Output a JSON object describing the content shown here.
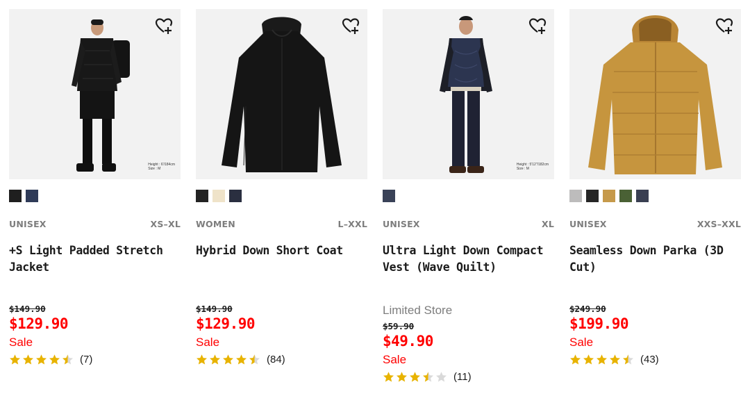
{
  "products": [
    {
      "gender": "UNISEX",
      "size_range": "XS–XL",
      "name": "+S Light Padded Stretch Jacket",
      "note": "",
      "original_price": "$149.90",
      "sale_price": "$129.90",
      "sale_label": "Sale",
      "rating": 4.5,
      "review_count": "(7)",
      "model_note": [
        "Height : 6'/184cm",
        "Size : M"
      ],
      "swatches": [
        "#1f1f1f",
        "#2f3b58"
      ],
      "fav_icon": "heart-plus-icon"
    },
    {
      "gender": "WOMEN",
      "size_range": "L–XXL",
      "name": "Hybrid Down Short Coat",
      "note": "",
      "original_price": "$149.90",
      "sale_price": "$129.90",
      "sale_label": "Sale",
      "rating": 4.5,
      "review_count": "(84)",
      "model_note": [],
      "swatches": [
        "#232323",
        "#efe3c9",
        "#2a2f40"
      ],
      "fav_icon": "heart-plus-icon"
    },
    {
      "gender": "UNISEX",
      "size_range": "XL",
      "name": "Ultra Light Down Compact Vest (Wave Quilt)",
      "note": "Limited Store",
      "original_price": "$59.90",
      "sale_price": "$49.90",
      "sale_label": "Sale",
      "rating": 3.5,
      "review_count": "(11)",
      "model_note": [
        "Height : 5'12\"/182cm",
        "Size : M"
      ],
      "swatches": [
        "#3a4258"
      ],
      "fav_icon": "heart-plus-icon"
    },
    {
      "gender": "UNISEX",
      "size_range": "XXS–XXL",
      "name": "Seamless Down Parka (3D Cut)",
      "note": "",
      "original_price": "$249.90",
      "sale_price": "$199.90",
      "sale_label": "Sale",
      "rating": 4.5,
      "review_count": "(43)",
      "model_note": [],
      "swatches": [
        "#bdbcbc",
        "#262626",
        "#c69a4b",
        "#4a6135",
        "#3a3f52"
      ],
      "fav_icon": "heart-plus-icon"
    }
  ],
  "colors": {
    "sale": "#ff0000",
    "star": "#e8b300",
    "star_empty": "#d9d9d9",
    "muted": "#7d7d7d"
  }
}
